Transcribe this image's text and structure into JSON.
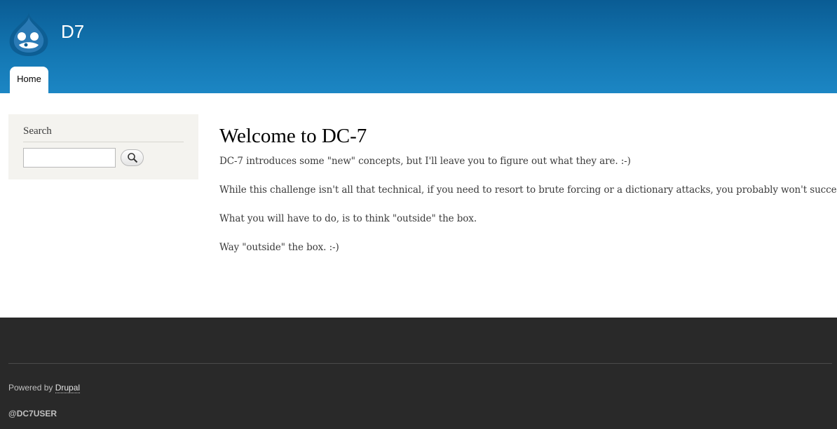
{
  "site": {
    "name": "D7",
    "colors": {
      "header_top": "#0a5c94",
      "header_bottom": "#1c86c4",
      "footer": "#292929"
    }
  },
  "nav": {
    "tabs": [
      {
        "label": "Home",
        "active": true
      }
    ]
  },
  "sidebar": {
    "search_block": {
      "title": "Search",
      "input_value": "",
      "button_icon": "search-icon"
    }
  },
  "main": {
    "title": "Welcome to DC-7",
    "paragraphs": [
      "DC-7 introduces some \"new\" concepts, but I'll leave you to figure out what they are.  :-)",
      "While this challenge isn't all that technical, if you need to resort to brute forcing or a dictionary attacks, you probably won't succeed.",
      "What you will have to do, is to think \"outside\" the box.",
      "Way \"outside\" the box.  :-)"
    ]
  },
  "footer": {
    "powered_prefix": "Powered by ",
    "powered_link": "Drupal",
    "handle": "@DC7USER"
  }
}
